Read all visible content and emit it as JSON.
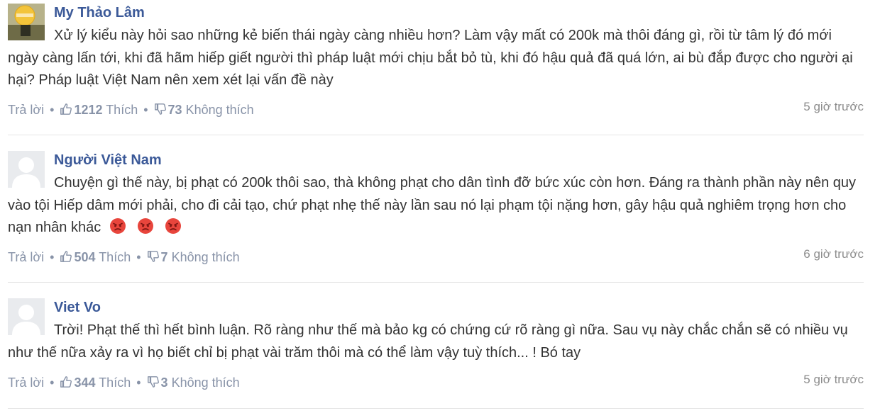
{
  "comments": [
    {
      "author": "My Thảo Lâm",
      "avatar_icon": "profile-photo",
      "text": "Xử lý kiểu này hỏi sao những kẻ biến thái ngày càng nhiều hơn? Làm vậy mất có 200k mà thôi đáng gì, rồi từ tâm lý đó mới ngày càng lấn tới, khi đã hãm hiếp giết người thì pháp luật mới chịu bắt bỏ tù, khi đó hậu quả đã quá lớn, ai bù đắp được cho người ại hại? Pháp luật Việt Nam nên xem xét lại vấn đề này",
      "reply_label": "Trả lời",
      "likes": "1212",
      "like_label": "Thích",
      "dislikes": "73",
      "dislike_label": "Không thích",
      "time": "5 giờ trước"
    },
    {
      "author": "Người Việt Nam",
      "avatar_icon": "default-avatar",
      "text": "Chuyện gì thế này, bị phạt có 200k thôi sao, thà không phạt cho dân tình đỡ bức xúc còn hơn. Đáng ra thành phần này nên quy vào tội Hiếp dâm mới phải, cho đi cải tạo, chứ phạt nhẹ thế này lần sau nó lại phạm tội nặng hơn, gây hậu quả nghiêm trọng hơn cho nạn nhân khác",
      "emojis": [
        "angry-face-icon",
        "angry-face-icon",
        "angry-face-icon"
      ],
      "reply_label": "Trả lời",
      "likes": "504",
      "like_label": "Thích",
      "dislikes": "7",
      "dislike_label": "Không thích",
      "time": "6 giờ trước"
    },
    {
      "author": "Viet Vo",
      "avatar_icon": "default-avatar",
      "text": "Trời! Phạt thế thì hết bình luận. Rõ ràng như thế mà bảo kg có chứng cứ rõ ràng gì nữa. Sau vụ này chắc chắn sẽ có nhiều vụ như thế nữa xảy ra vì họ biết chỉ bị phạt vài trăm thôi mà có thể làm vậy tuỳ thích... ! Bó tay",
      "reply_label": "Trả lời",
      "likes": "344",
      "like_label": "Thích",
      "dislikes": "3",
      "dislike_label": "Không thích",
      "time": "5 giờ trước"
    }
  ],
  "colors": {
    "author": "#3b5998",
    "meta": "#8893a8",
    "body_text": "#333333",
    "divider": "#e5e5e5",
    "emoji_red": "#e8453c"
  }
}
